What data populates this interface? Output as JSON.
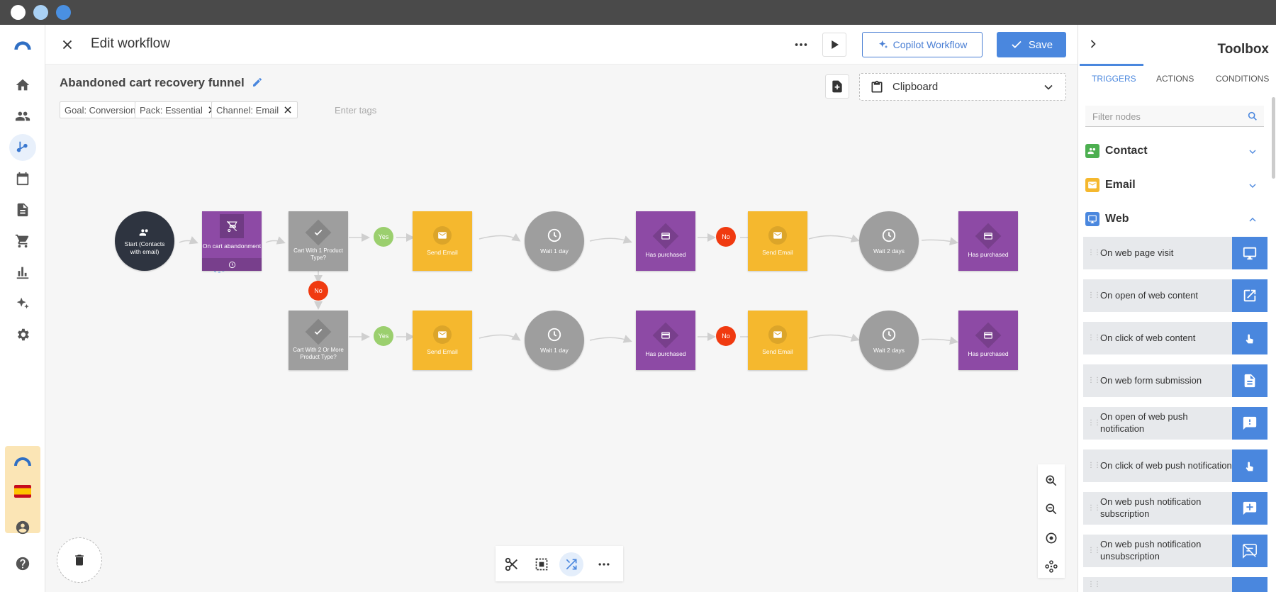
{
  "header": {
    "title": "Edit workflow",
    "copilot_label": "Copilot Workflow",
    "save_label": "Save"
  },
  "workflow": {
    "name": "Abandoned cart recovery funnel",
    "tags": [
      "Goal: Conversion",
      "Pack: Essential",
      "Channel: Email"
    ],
    "tags_placeholder": "Enter tags",
    "clipboard_label": "Clipboard"
  },
  "flow": {
    "start": "Start (Contacts with email)",
    "trigger": "On cart abandonment",
    "cond_top": "Cart With 1 Product Type?",
    "cond_bottom": "Cart With 2 Or More Product Type?",
    "yes": "Yes",
    "no": "No",
    "send_email": "Send Email",
    "wait_1": "Wait 1 day",
    "wait_2": "Wait 2 days",
    "has_purchased": "Has purchased"
  },
  "toolbox": {
    "title": "Toolbox",
    "tabs": [
      "TRIGGERS",
      "ACTIONS",
      "CONDITIONS"
    ],
    "filter_placeholder": "Filter nodes",
    "categories": [
      {
        "label": "Contact",
        "color": "#4caf50"
      },
      {
        "label": "Email",
        "color": "#f5b82e"
      },
      {
        "label": "Web",
        "color": "#4a87de"
      }
    ],
    "items": [
      {
        "label": "On web page visit",
        "icon": "monitor-icon"
      },
      {
        "label": "On open of web content",
        "icon": "open-external-icon"
      },
      {
        "label": "On click of web content",
        "icon": "pointer-icon"
      },
      {
        "label": "On web form submission",
        "icon": "form-icon"
      },
      {
        "label": "On open of web push notification",
        "icon": "notification-alert-icon"
      },
      {
        "label": "On click of web push notification",
        "icon": "pointer-icon"
      },
      {
        "label": "On web push notification subscription",
        "icon": "notification-add-icon"
      },
      {
        "label": "On web push notification unsubscription",
        "icon": "notification-off-icon"
      }
    ]
  },
  "colors": {
    "accent": "#4a87de",
    "purple": "#8d4aa5",
    "yellow": "#f5b82e",
    "gray": "#9e9e9e",
    "dark": "#2e3440",
    "yes": "#9bcf6e",
    "no": "#f03a10"
  }
}
